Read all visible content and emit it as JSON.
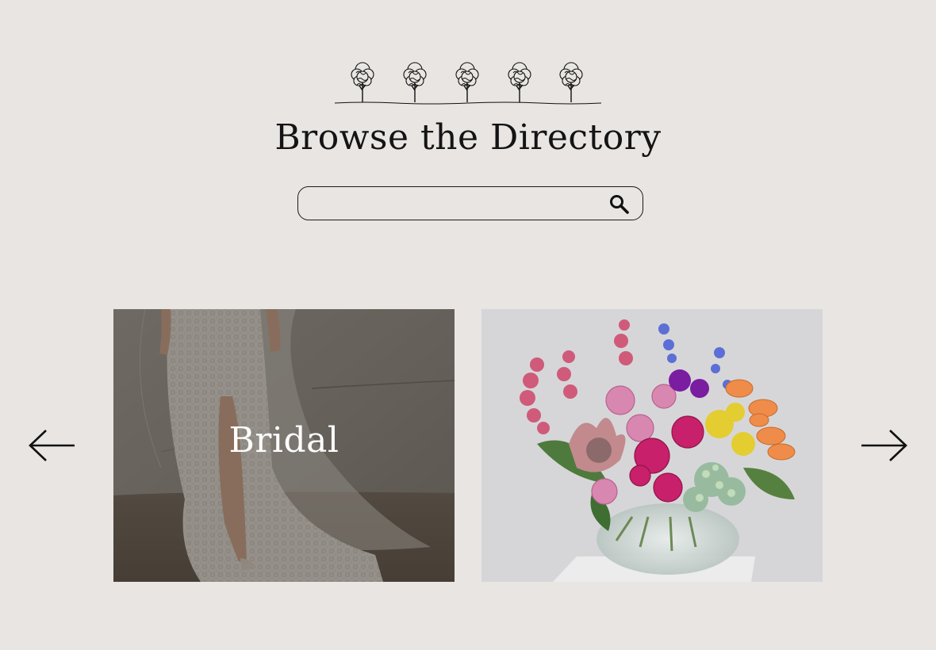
{
  "header": {
    "logo_icon": "tree-row-icon",
    "title": "Browse the Directory"
  },
  "search": {
    "value": "",
    "placeholder": "",
    "icon": "search-icon"
  },
  "carousel": {
    "prev_icon": "arrow-left-icon",
    "next_icon": "arrow-right-icon",
    "cards": [
      {
        "label": "Bridal",
        "image": "wedding-dress-photo"
      },
      {
        "label": "",
        "image": "flower-bouquet-photo"
      }
    ]
  },
  "colors": {
    "background": "#e8e5e2",
    "text": "#141414",
    "overlay_label": "#ffffff"
  }
}
